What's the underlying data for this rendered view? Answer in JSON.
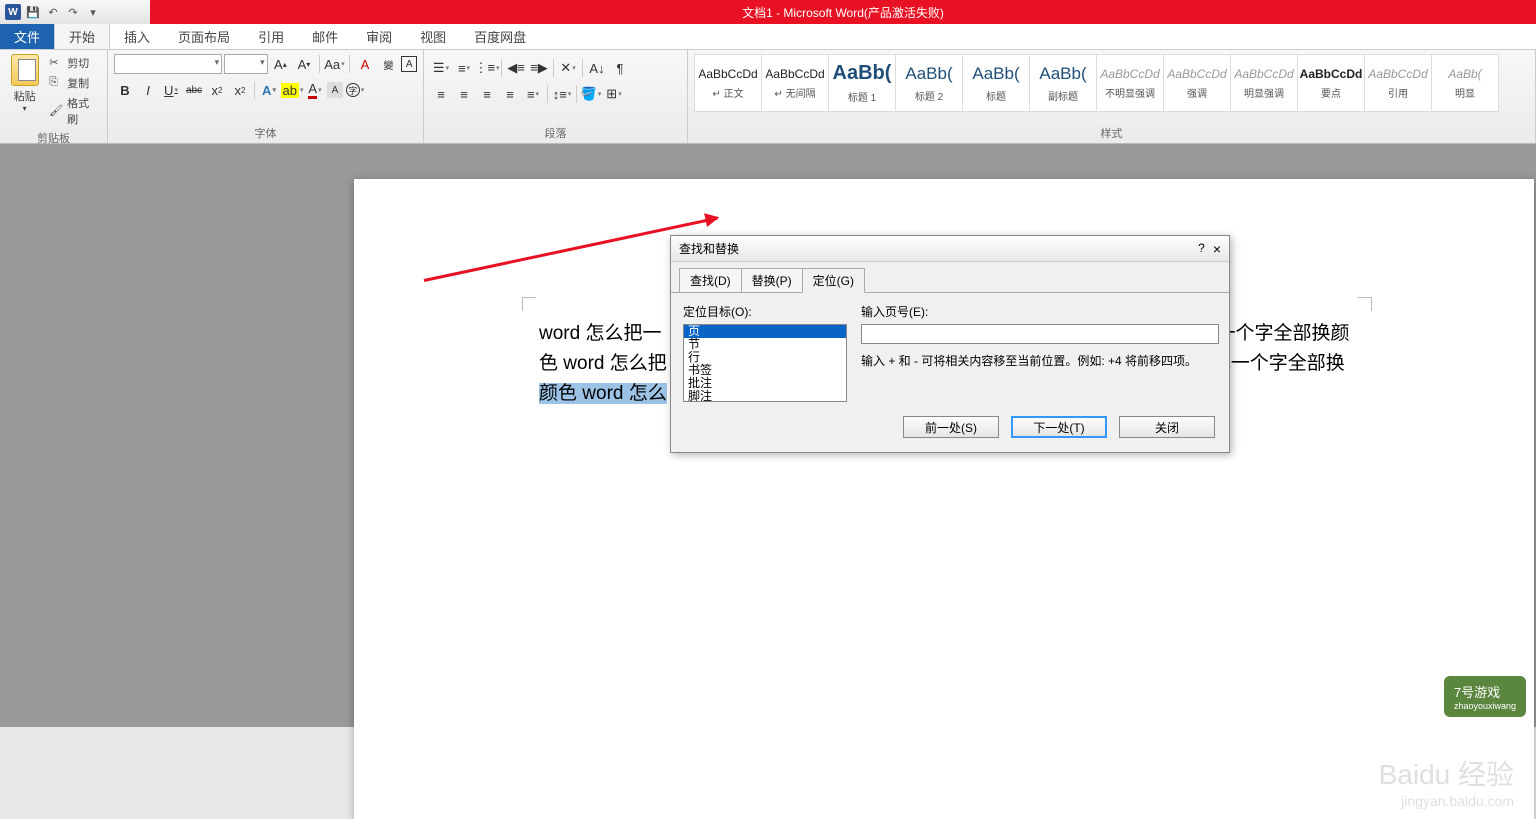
{
  "app": {
    "title": "文档1 - Microsoft Word(产品激活失败)"
  },
  "tabs": {
    "file": "文件",
    "items": [
      "开始",
      "插入",
      "页面布局",
      "引用",
      "邮件",
      "审阅",
      "视图",
      "百度网盘"
    ],
    "active": 0
  },
  "clipboard": {
    "paste": "粘贴",
    "cut": "剪切",
    "copy": "复制",
    "format_painter": "格式刷",
    "group": "剪贴板"
  },
  "font": {
    "name": "",
    "size": "",
    "group": "字体",
    "bold": "B",
    "italic": "I",
    "underline": "U",
    "strike": "abc",
    "sub": "x₂",
    "sup": "x²",
    "grow": "A^",
    "shrink": "A˅",
    "case": "Aa",
    "clear": "A",
    "phonetic": "拼",
    "border": "A"
  },
  "paragraph": {
    "group": "段落"
  },
  "styles": {
    "group": "样式",
    "items": [
      {
        "sample": "AaBbCcDd",
        "name": "↵ 正文",
        "cls": "black"
      },
      {
        "sample": "AaBbCcDd",
        "name": "↵ 无间隔",
        "cls": "black"
      },
      {
        "sample": "AaBb(",
        "name": "标题 1",
        "cls": "big"
      },
      {
        "sample": "AaBb(",
        "name": "标题 2",
        "cls": ""
      },
      {
        "sample": "AaBb(",
        "name": "标题",
        "cls": ""
      },
      {
        "sample": "AaBb(",
        "name": "副标题",
        "cls": ""
      },
      {
        "sample": "AaBbCcDd",
        "name": "不明显强调",
        "cls": "gray"
      },
      {
        "sample": "AaBbCcDd",
        "name": "强调",
        "cls": "gray"
      },
      {
        "sample": "AaBbCcDd",
        "name": "明显强调",
        "cls": "gray"
      },
      {
        "sample": "AaBbCcDd",
        "name": "要点",
        "cls": "black"
      },
      {
        "sample": "AaBbCcDd",
        "name": "引用",
        "cls": "gray"
      },
      {
        "sample": "AaBb(",
        "name": "明显",
        "cls": "gray"
      }
    ]
  },
  "document": {
    "line1a": "word 怎么把一",
    "line1b": "一个字全部换颜",
    "line2a": "色 word 怎么把",
    "line2b": "把一个字全部换",
    "line3_hl": "颜色 word 怎么"
  },
  "dialog": {
    "title": "查找和替换",
    "help": "?",
    "close": "×",
    "tabs": {
      "find": "查找(D)",
      "replace": "替换(P)",
      "goto": "定位(G)"
    },
    "goto_target_label": "定位目标(O):",
    "goto_items": [
      "页",
      "节",
      "行",
      "书签",
      "批注",
      "脚注"
    ],
    "page_num_label": "输入页号(E):",
    "page_num_value": "",
    "hint": "输入 + 和 - 可将相关内容移至当前位置。例如: +4 将前移四项。",
    "prev": "前一处(S)",
    "next": "下一处(T)",
    "close_btn": "关闭"
  },
  "watermark": {
    "main": "Baidu 经验",
    "sub": "jingyan.baidu.com",
    "badge": "7号游戏",
    "badge_sub": "zhaoyouxiwang"
  }
}
